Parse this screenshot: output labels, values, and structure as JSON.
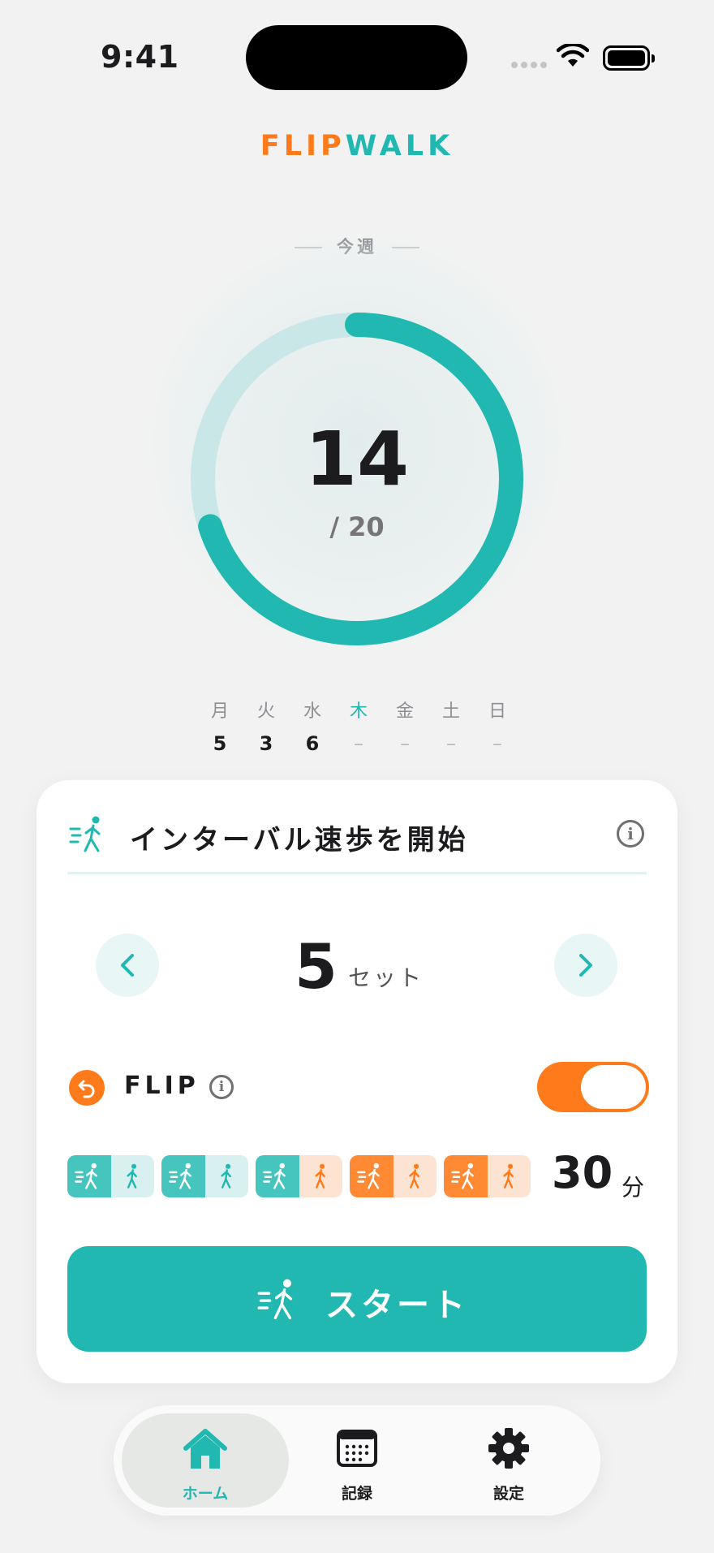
{
  "status_bar": {
    "time": "9:41"
  },
  "brand": {
    "part1": "FLIP",
    "part2": "WALK"
  },
  "weekly": {
    "label": "今週",
    "count": "14",
    "goal": "/ 20",
    "progress_fraction": 0.7,
    "days": [
      {
        "name": "月",
        "value": "5"
      },
      {
        "name": "火",
        "value": "3"
      },
      {
        "name": "水",
        "value": "6"
      },
      {
        "name": "木",
        "value": "–"
      },
      {
        "name": "金",
        "value": "–"
      },
      {
        "name": "土",
        "value": "–"
      },
      {
        "name": "日",
        "value": "–"
      }
    ]
  },
  "card": {
    "title": "インターバル速歩を開始",
    "info_icon": "info-icon",
    "sets_value": "5",
    "sets_unit": "セット",
    "flip_label": "FLIP",
    "flip_enabled": true,
    "blocks": [
      "teal",
      "teal",
      "mixed",
      "orange",
      "orange"
    ],
    "total_value": "30",
    "total_unit": "分",
    "start_label": "スタート"
  },
  "tabbar": {
    "tabs": [
      {
        "label": "ホーム",
        "icon": "home-icon",
        "active": true
      },
      {
        "label": "記録",
        "icon": "calendar-icon",
        "active": false
      },
      {
        "label": "設定",
        "icon": "gear-icon",
        "active": false
      }
    ]
  },
  "colors": {
    "teal": "#20b8b0",
    "orange": "#ff7a1a",
    "background": "#f2f2f2"
  }
}
